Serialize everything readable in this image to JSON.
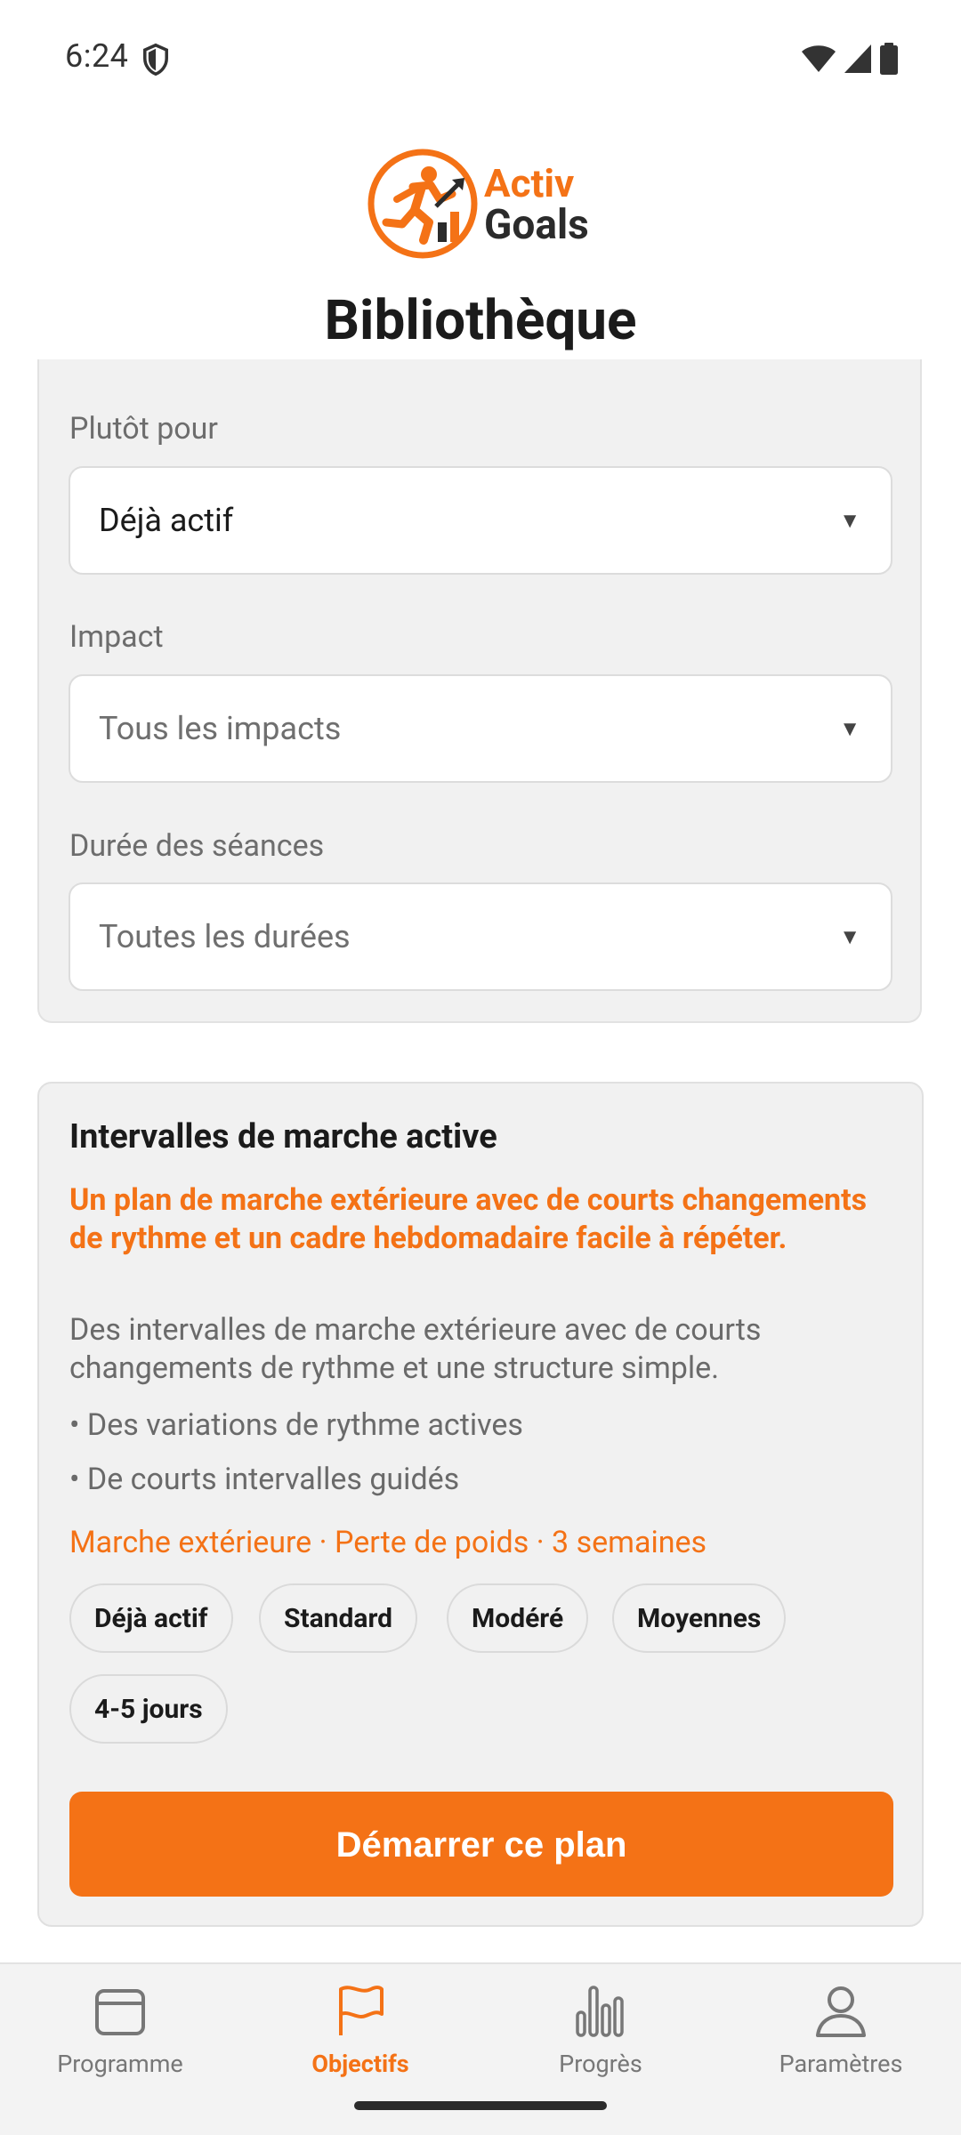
{
  "status_bar": {
    "time": "6:24"
  },
  "header": {
    "logo_line1": "Activ",
    "logo_line2": "Goals",
    "title": "Bibliothèque"
  },
  "filters": {
    "audience": {
      "label": "Plutôt pour",
      "value": "Déjà actif"
    },
    "impact": {
      "label": "Impact",
      "placeholder": "Tous les impacts"
    },
    "duration": {
      "label": "Durée des séances",
      "placeholder": "Toutes les durées"
    }
  },
  "plan": {
    "title": "Intervalles de marche active",
    "tagline": "Un plan de marche extérieure avec de courts changements de rythme et un cadre hebdomadaire facile à répéter.",
    "description": "Des intervalles de marche extérieure avec de courts changements de rythme et une structure simple.",
    "bullets": [
      "• Des variations de rythme actives",
      "• De courts intervalles guidés"
    ],
    "meta": "Marche extérieure · Perte de poids · 3 semaines",
    "chips": [
      "Déjà actif",
      "Standard",
      "Modéré",
      "Moyennes",
      "4-5 jours"
    ],
    "start_label": "Démarrer ce plan"
  },
  "nav": {
    "items": [
      {
        "label": "Programme",
        "icon": "calendar-icon",
        "active": false
      },
      {
        "label": "Objectifs",
        "icon": "flag-icon",
        "active": true
      },
      {
        "label": "Progrès",
        "icon": "bar-chart-icon",
        "active": false
      },
      {
        "label": "Paramètres",
        "icon": "person-icon",
        "active": false
      }
    ]
  },
  "colors": {
    "accent": "#f47216",
    "card_bg": "#f1f1f1",
    "text_muted": "#6a6a6a"
  }
}
